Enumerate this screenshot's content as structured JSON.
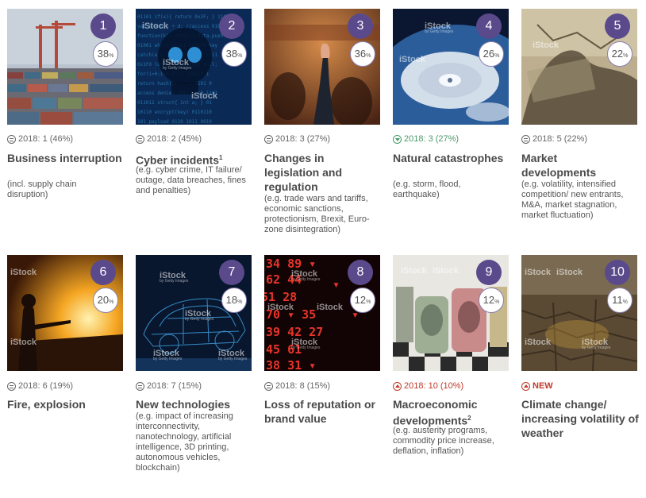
{
  "watermark": {
    "brand": "iStock",
    "sub": "by Getty Images"
  },
  "percent_sign": "%",
  "colors": {
    "rank_badge": "#5a4a8c",
    "green": "#4a9b6a",
    "red": "#c0392b"
  },
  "risks": [
    {
      "rank": "1",
      "pct": "38",
      "meta": "2018: 1 (46%)",
      "trend": "equal",
      "title": "Business interruption",
      "desc": "(incl. supply chain disruption)"
    },
    {
      "rank": "2",
      "pct": "38",
      "meta": "2018: 2 (45%)",
      "trend": "equal",
      "title": "Cyber incidents",
      "footnote": "1",
      "desc": "(e.g. cyber crime, IT failure/ outage, data breaches, fines and penalties)"
    },
    {
      "rank": "3",
      "pct": "36",
      "meta": "2018: 3 (27%)",
      "trend": "equal",
      "title": "Changes in legislation and regulation",
      "desc": "(e.g. trade wars and tariffs, economic sanctions, protectionism, Brexit, Euro-zone disintegration)"
    },
    {
      "rank": "4",
      "pct": "26",
      "meta": "2018: 3 (27%)",
      "trend": "down",
      "title": "Natural catastrophes",
      "desc": "(e.g. storm, flood, earthquake)"
    },
    {
      "rank": "5",
      "pct": "22",
      "meta": "2018: 5 (22%)",
      "trend": "equal",
      "title": "Market developments",
      "desc": "(e.g. volatility, intensified competition/ new entrants, M&A, market stagnation, market fluctuation)"
    },
    {
      "rank": "6",
      "pct": "20",
      "meta": "2018: 6 (19%)",
      "trend": "equal",
      "title": "Fire, explosion",
      "desc": ""
    },
    {
      "rank": "7",
      "pct": "18",
      "meta": "2018: 7 (15%)",
      "trend": "equal",
      "title": "New technologies",
      "desc": "(e.g. impact of increasing interconnectivity, nanotechnology, artificial intelligence, 3D printing, autonomous vehicles, blockchain)"
    },
    {
      "rank": "8",
      "pct": "12",
      "meta": "2018: 8 (15%)",
      "trend": "equal",
      "title": "Loss of reputation or brand value",
      "desc": ""
    },
    {
      "rank": "9",
      "pct": "12",
      "meta": "2018: 10 (10%)",
      "trend": "up",
      "title": "Macroeconomic developments",
      "footnote": "2",
      "desc": "(e.g. austerity programs, commodity price increase, deflation, inflation)"
    },
    {
      "rank": "10",
      "pct": "11",
      "meta": "NEW",
      "trend": "up",
      "title": "Climate change/ increasing volatility of weather",
      "desc": ""
    }
  ]
}
